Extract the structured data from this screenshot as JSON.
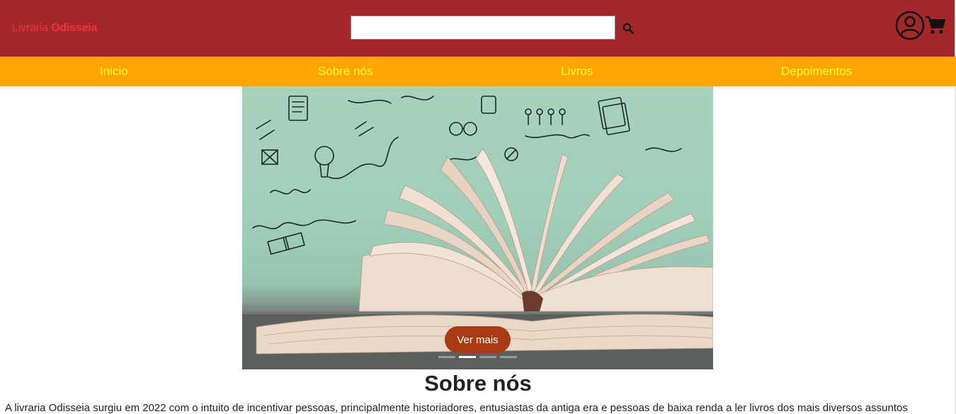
{
  "header": {
    "logo_prefix": "Livraria",
    "logo_name": "Odisseia",
    "search_placeholder": "",
    "icons": {
      "search": "search-icon",
      "user": "user-circle-icon",
      "cart": "shopping-cart-icon"
    }
  },
  "nav": {
    "items": [
      {
        "label": "Inicio"
      },
      {
        "label": "Sobre nós"
      },
      {
        "label": "Livros"
      },
      {
        "label": "Depoimentos"
      }
    ]
  },
  "carousel": {
    "image_subject": "open book with doodles",
    "button_label": "Ver mais",
    "slides": 4,
    "active_slide": 2
  },
  "about": {
    "title": "Sobre nós",
    "text": "A livraria Odisseia surgiu em 2022 com o intuito de incentivar pessoas, principalmente historiadores, entusiastas da antiga era e pessoas de baixa renda a ler livros dos mais diversos assuntos"
  },
  "colors": {
    "header_bg": "#a4272a",
    "logo": "#f0303a",
    "nav_bg": "#ffa500",
    "nav_text": "#ffff33",
    "button_bg": "#a93a13"
  }
}
